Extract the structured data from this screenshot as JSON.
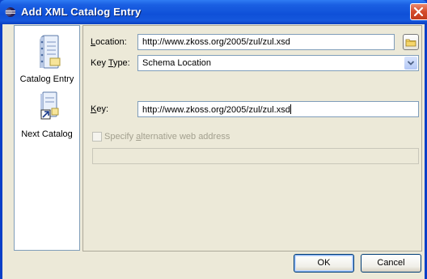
{
  "window": {
    "title": "Add XML Catalog Entry"
  },
  "nav": {
    "items": [
      {
        "label": "Catalog Entry",
        "icon": "catalog-entry-icon"
      },
      {
        "label": "Next Catalog",
        "icon": "next-catalog-icon"
      }
    ]
  },
  "form": {
    "location": {
      "label_prefix": "",
      "label_mnemonic": "L",
      "label_rest": "ocation:",
      "value": "http://www.zkoss.org/2005/zul/zul.xsd"
    },
    "key_type": {
      "label_prefix": "Key ",
      "label_mnemonic": "T",
      "label_rest": "ype:",
      "value": "Schema Location"
    },
    "key": {
      "label_prefix": "",
      "label_mnemonic": "K",
      "label_rest": "ey:",
      "value": "http://www.zkoss.org/2005/zul/zul.xsd"
    },
    "alt_address": {
      "label_prefix": "Specify ",
      "label_mnemonic": "a",
      "label_rest": "lternative web address",
      "checked": false,
      "value": ""
    }
  },
  "buttons": {
    "ok": "OK",
    "cancel": "Cancel"
  },
  "colors": {
    "titlebar": "#0f50d8",
    "dialog_bg": "#ece9d8",
    "close_button": "#d44a2a"
  }
}
